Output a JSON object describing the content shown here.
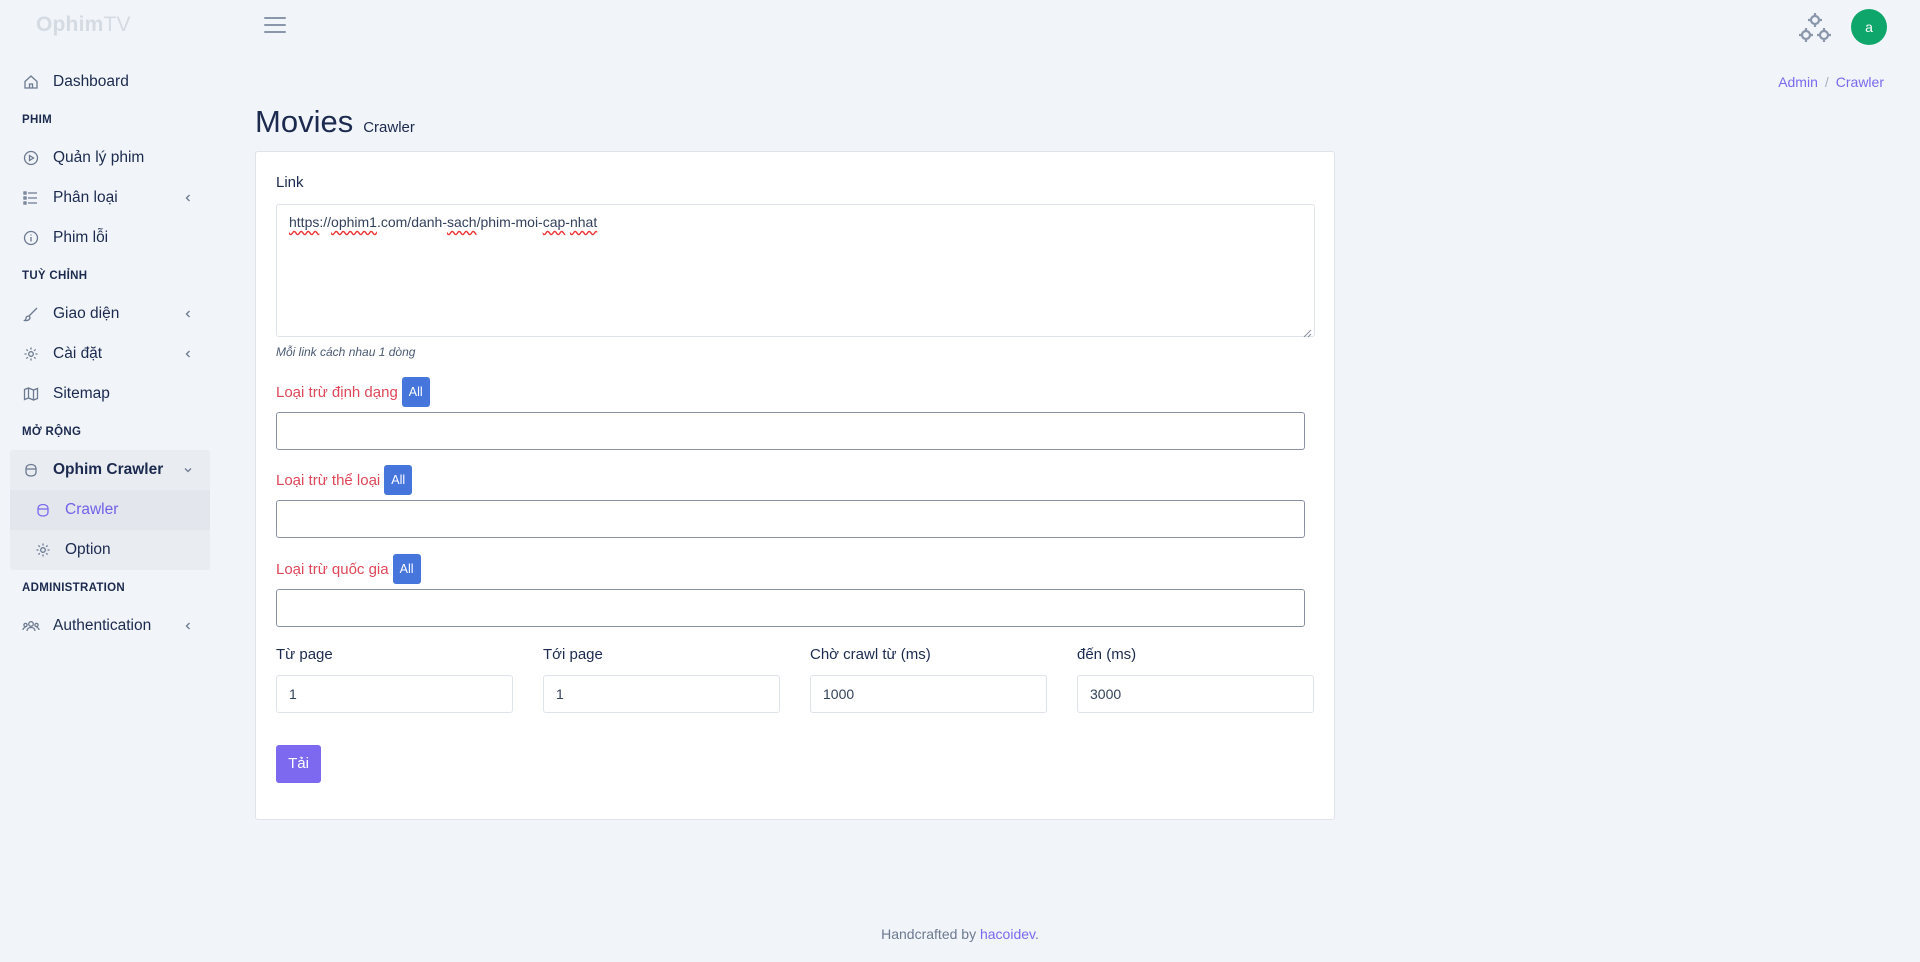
{
  "brand": {
    "bold": "Ophim",
    "light": "TV"
  },
  "user": {
    "avatar_letter": "a"
  },
  "sidebar": {
    "dashboard": "Dashboard",
    "section_phim": "PHIM",
    "quan_ly_phim": "Quản lý phim",
    "phan_loai": "Phân loại",
    "phim_loi": "Phim lỗi",
    "section_tuy_chinh": "TUỲ CHỈNH",
    "giao_dien": "Giao diện",
    "cai_dat": "Cài đặt",
    "sitemap": "Sitemap",
    "section_mo_rong": "MỞ RỘNG",
    "ophim_crawler": "Ophim Crawler",
    "crawler": "Crawler",
    "option": "Option",
    "section_admin": "ADMINISTRATION",
    "authentication": "Authentication"
  },
  "breadcrumb": {
    "admin": "Admin",
    "sep": "/",
    "current": "Crawler"
  },
  "page": {
    "title": "Movies",
    "subtitle": "Crawler"
  },
  "form": {
    "link_label": "Link",
    "link_parts": [
      "https",
      "://",
      "ophim1",
      ".com/",
      "danh",
      "-",
      "sach",
      "/phim-moi-",
      "cap",
      "-",
      "nhat"
    ],
    "link_hint": "Mỗi link cách nhau 1 dòng",
    "exclude_format_label": "Loại trừ định dạng",
    "exclude_genre_label": "Loại trừ thể loại",
    "exclude_country_label": "Loại trừ quốc gia",
    "all_label": "All",
    "from_page_label": "Từ page",
    "from_page_value": "1",
    "to_page_label": "Tới page",
    "to_page_value": "1",
    "wait_from_label": "Chờ crawl từ (ms)",
    "wait_from_value": "1000",
    "wait_to_label": "đến (ms)",
    "wait_to_value": "3000",
    "submit_label": "Tải"
  },
  "footer": {
    "text": "Handcrafted by ",
    "author": "hacoidev",
    "dot": "."
  }
}
